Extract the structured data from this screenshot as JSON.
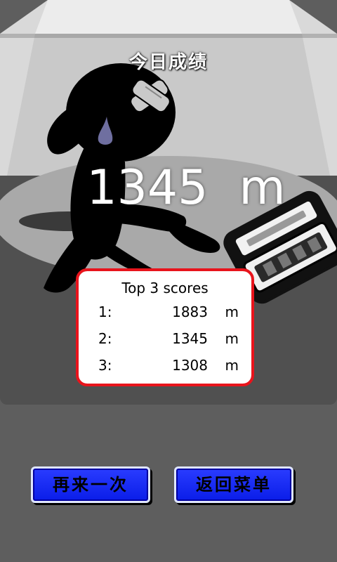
{
  "header": {
    "title": "今日成绩"
  },
  "result": {
    "distance": "1345",
    "unit": "m"
  },
  "top_scores": {
    "title": "Top 3 scores",
    "entries": [
      {
        "rank": "1:",
        "value": "1883",
        "unit": "m"
      },
      {
        "rank": "2:",
        "value": "1345",
        "unit": "m"
      },
      {
        "rank": "3:",
        "value": "1308",
        "unit": "m"
      }
    ]
  },
  "buttons": {
    "retry_label": "再来一次",
    "menu_label": "返回菜单"
  },
  "colors": {
    "background": "#5e5e5e",
    "panel_border": "#e8141c",
    "button_blue": "#1a2cf5"
  },
  "icons": {
    "character": "stick-figure-silhouette",
    "bandage": "bandage-cross-icon",
    "sweat": "sweat-drop-icon",
    "vehicle": "crashed-car-icon"
  }
}
